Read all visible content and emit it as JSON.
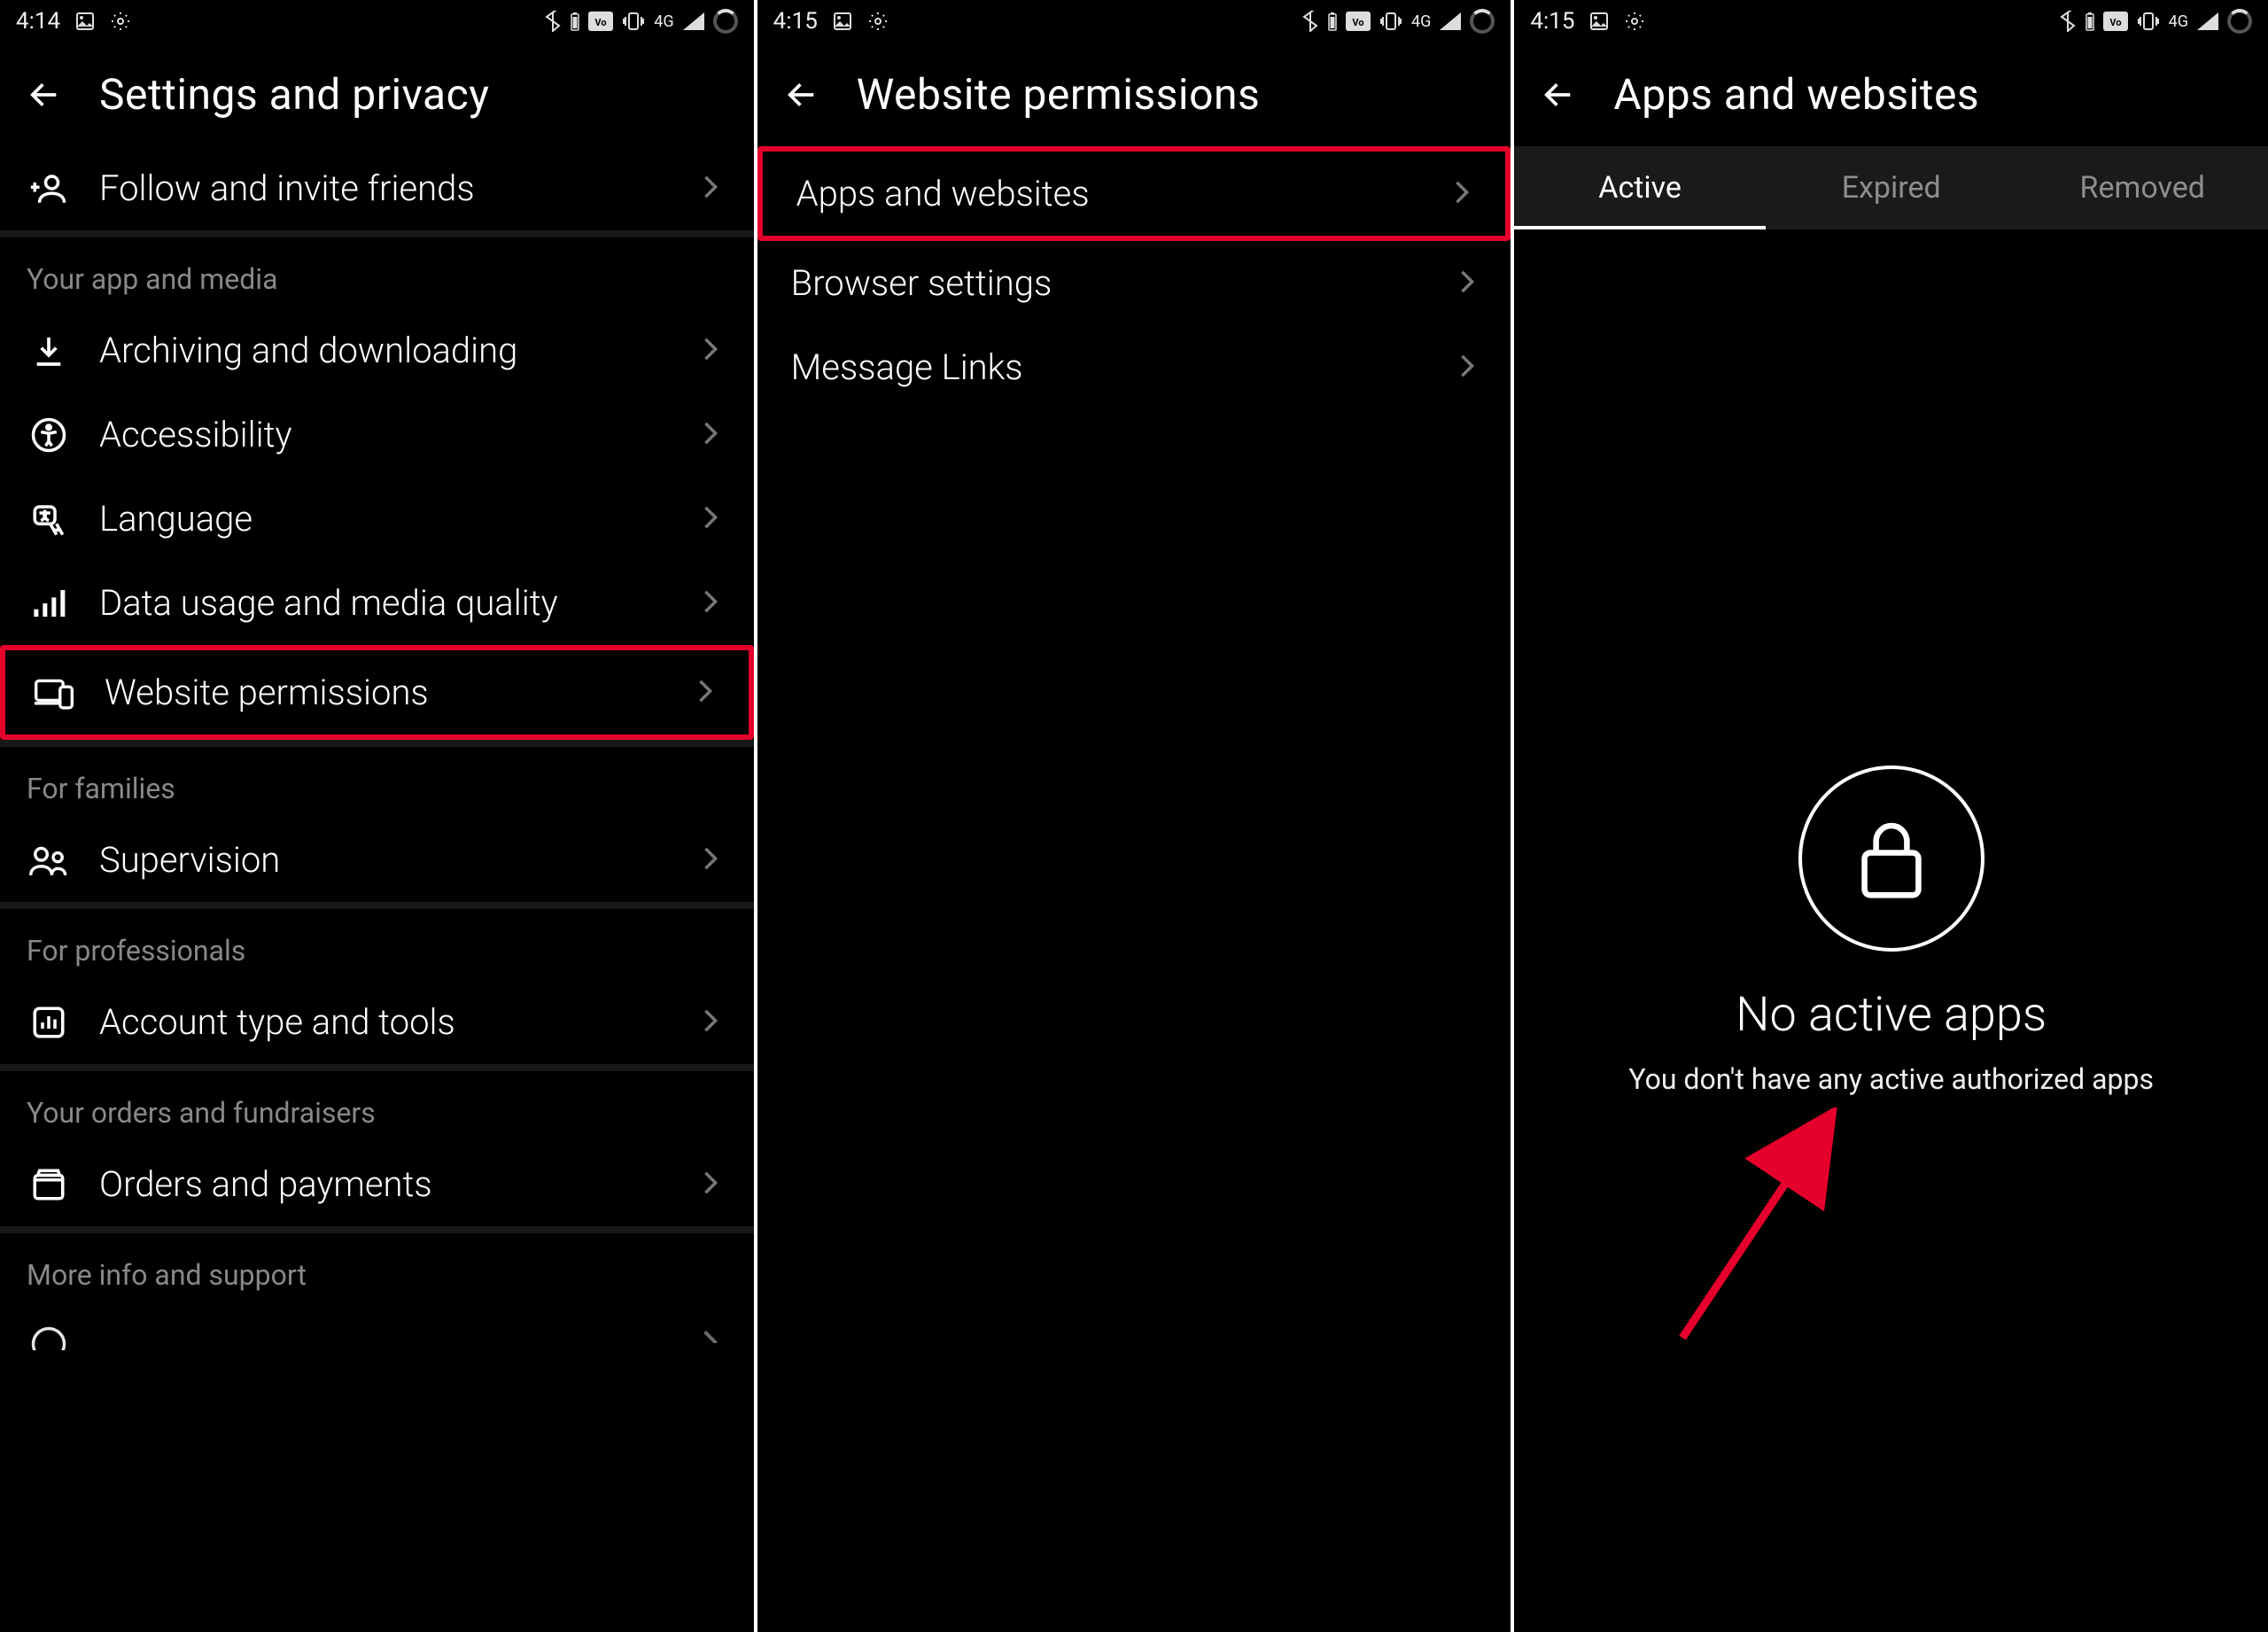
{
  "screen1": {
    "time": "4:14",
    "title": "Settings and privacy",
    "follow_invite": "Follow and invite friends",
    "sections": {
      "app_media": {
        "label": "Your app and media",
        "items": {
          "archiving": "Archiving and downloading",
          "accessibility": "Accessibility",
          "language": "Language",
          "data_usage": "Data usage and media quality",
          "website_permissions": "Website permissions"
        }
      },
      "families": {
        "label": "For families",
        "items": {
          "supervision": "Supervision"
        }
      },
      "professionals": {
        "label": "For professionals",
        "items": {
          "account_tools": "Account type and tools"
        }
      },
      "orders": {
        "label": "Your orders and fundraisers",
        "items": {
          "orders_payments": "Orders and payments"
        }
      },
      "more_info": {
        "label": "More info and support"
      }
    }
  },
  "screen2": {
    "time": "4:15",
    "title": "Website permissions",
    "items": {
      "apps_websites": "Apps and websites",
      "browser_settings": "Browser settings",
      "message_links": "Message Links"
    }
  },
  "screen3": {
    "time": "4:15",
    "title": "Apps and websites",
    "tabs": {
      "active": "Active",
      "expired": "Expired",
      "removed": "Removed"
    },
    "empty": {
      "title": "No active apps",
      "sub": "You don't have any active authorized apps"
    }
  }
}
